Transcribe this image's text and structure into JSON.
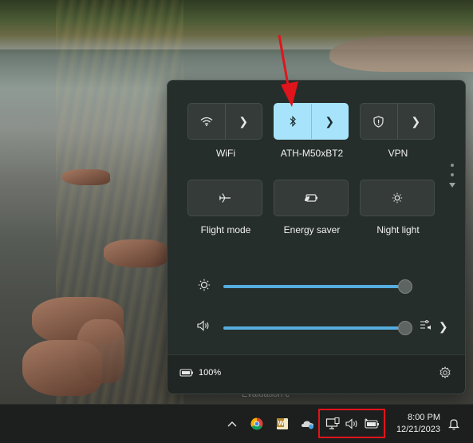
{
  "quick_settings": {
    "tiles": [
      {
        "id": "wifi",
        "label": "WiFi",
        "icon": "wifi-icon",
        "split": true,
        "active": false
      },
      {
        "id": "bluetooth",
        "label": "ATH-M50xBT2",
        "icon": "bluetooth-icon",
        "split": true,
        "active": true
      },
      {
        "id": "vpn",
        "label": "VPN",
        "icon": "shield-icon",
        "split": true,
        "active": false
      },
      {
        "id": "flight",
        "label": "Flight mode",
        "icon": "airplane-icon",
        "split": false,
        "active": false
      },
      {
        "id": "energy",
        "label": "Energy saver",
        "icon": "leaf-battery-icon",
        "split": false,
        "active": false
      },
      {
        "id": "night",
        "label": "Night light",
        "icon": "sun-icon",
        "split": false,
        "active": false
      }
    ],
    "brightness_level": 0.99,
    "volume_level": 0.99,
    "battery": {
      "percent": "100%"
    },
    "accent_color": "#a7e4fb",
    "slider_color": "#55ade0"
  },
  "watermark": {
    "text": "Evaluation c"
  },
  "taskbar": {
    "tray_icons": [
      "show-hidden-icons-chevron",
      "chrome-icon",
      "word-icon",
      "onedrive-icon",
      "network-icon",
      "volume-icon",
      "battery-icon"
    ],
    "time": "8:00 PM",
    "date": "12/21/2023",
    "highlight_color": "#e0141c"
  }
}
